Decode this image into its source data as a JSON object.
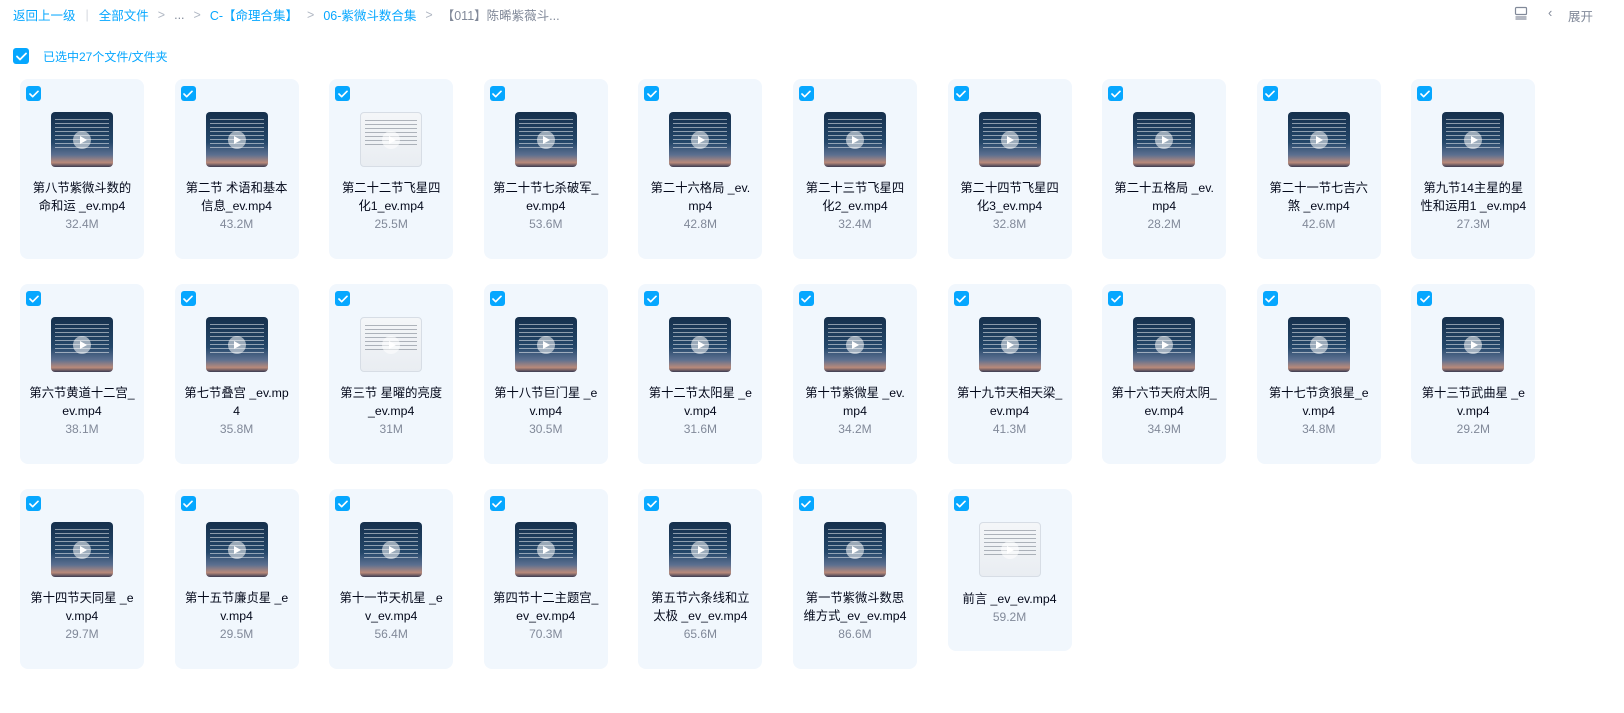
{
  "breadcrumb": {
    "back": "返回上一级",
    "items": [
      "全部文件",
      "...",
      "C-【命理合集】",
      "06-紫微斗数合集"
    ],
    "current": "【011】陈晞紫薇斗...",
    "separator": ">"
  },
  "toolbar": {
    "expand_label": "展开",
    "back_icon": "chevron-left-icon",
    "layout_icon": "layout-icon"
  },
  "selection": {
    "label": "已选中27个文件/文件夹",
    "all_selected": true
  },
  "colors": {
    "accent": "#06a7ff",
    "card_bg": "#f1f7fd",
    "meta": "#818999"
  },
  "files": [
    {
      "name": "第八节紫微斗数的命和运 _ev.mp4",
      "size": "32.4M"
    },
    {
      "name": "第二节 术语和基本信息_ev.mp4",
      "size": "43.2M"
    },
    {
      "name": "第二十二节飞星四化1_ev.mp4",
      "size": "25.5M"
    },
    {
      "name": "第二十节七杀破军_ev.mp4",
      "size": "53.6M"
    },
    {
      "name": "第二十六格局 _ev.mp4",
      "size": "42.8M"
    },
    {
      "name": "第二十三节飞星四化2_ev.mp4",
      "size": "32.4M"
    },
    {
      "name": "第二十四节飞星四化3_ev.mp4",
      "size": "32.8M"
    },
    {
      "name": "第二十五格局 _ev.mp4",
      "size": "28.2M"
    },
    {
      "name": "第二十一节七吉六煞 _ev.mp4",
      "size": "42.6M"
    },
    {
      "name": "第九节14主星的星性和运用1 _ev.mp4",
      "size": "27.3M"
    },
    {
      "name": "第六节黄道十二宫_ev.mp4",
      "size": "38.1M"
    },
    {
      "name": "第七节叠宫 _ev.mp4",
      "size": "35.8M"
    },
    {
      "name": "第三节 星曜的亮度_ev.mp4",
      "size": "31M"
    },
    {
      "name": "第十八节巨门星 _ev.mp4",
      "size": "30.5M"
    },
    {
      "name": "第十二节太阳星 _ev.mp4",
      "size": "31.6M"
    },
    {
      "name": "第十节紫微星 _ev.mp4",
      "size": "34.2M"
    },
    {
      "name": "第十九节天相天梁_ev.mp4",
      "size": "41.3M"
    },
    {
      "name": "第十六节天府太阴_ev.mp4",
      "size": "34.9M"
    },
    {
      "name": "第十七节贪狼星_ev.mp4",
      "size": "34.8M"
    },
    {
      "name": "第十三节武曲星 _ev.mp4",
      "size": "29.2M"
    },
    {
      "name": "第十四节天同星 _ev.mp4",
      "size": "29.7M"
    },
    {
      "name": "第十五节廉贞星 _ev.mp4",
      "size": "29.5M"
    },
    {
      "name": "第十一节天机星 _ev_ev.mp4",
      "size": "56.4M"
    },
    {
      "name": "第四节十二主题宫_ev_ev.mp4",
      "size": "70.3M"
    },
    {
      "name": "第五节六条线和立太极 _ev_ev.mp4",
      "size": "65.6M"
    },
    {
      "name": "第一节紫微斗数思维方式_ev_ev.mp4",
      "size": "86.6M"
    },
    {
      "name": "前言 _ev_ev.mp4",
      "size": "59.2M"
    }
  ]
}
